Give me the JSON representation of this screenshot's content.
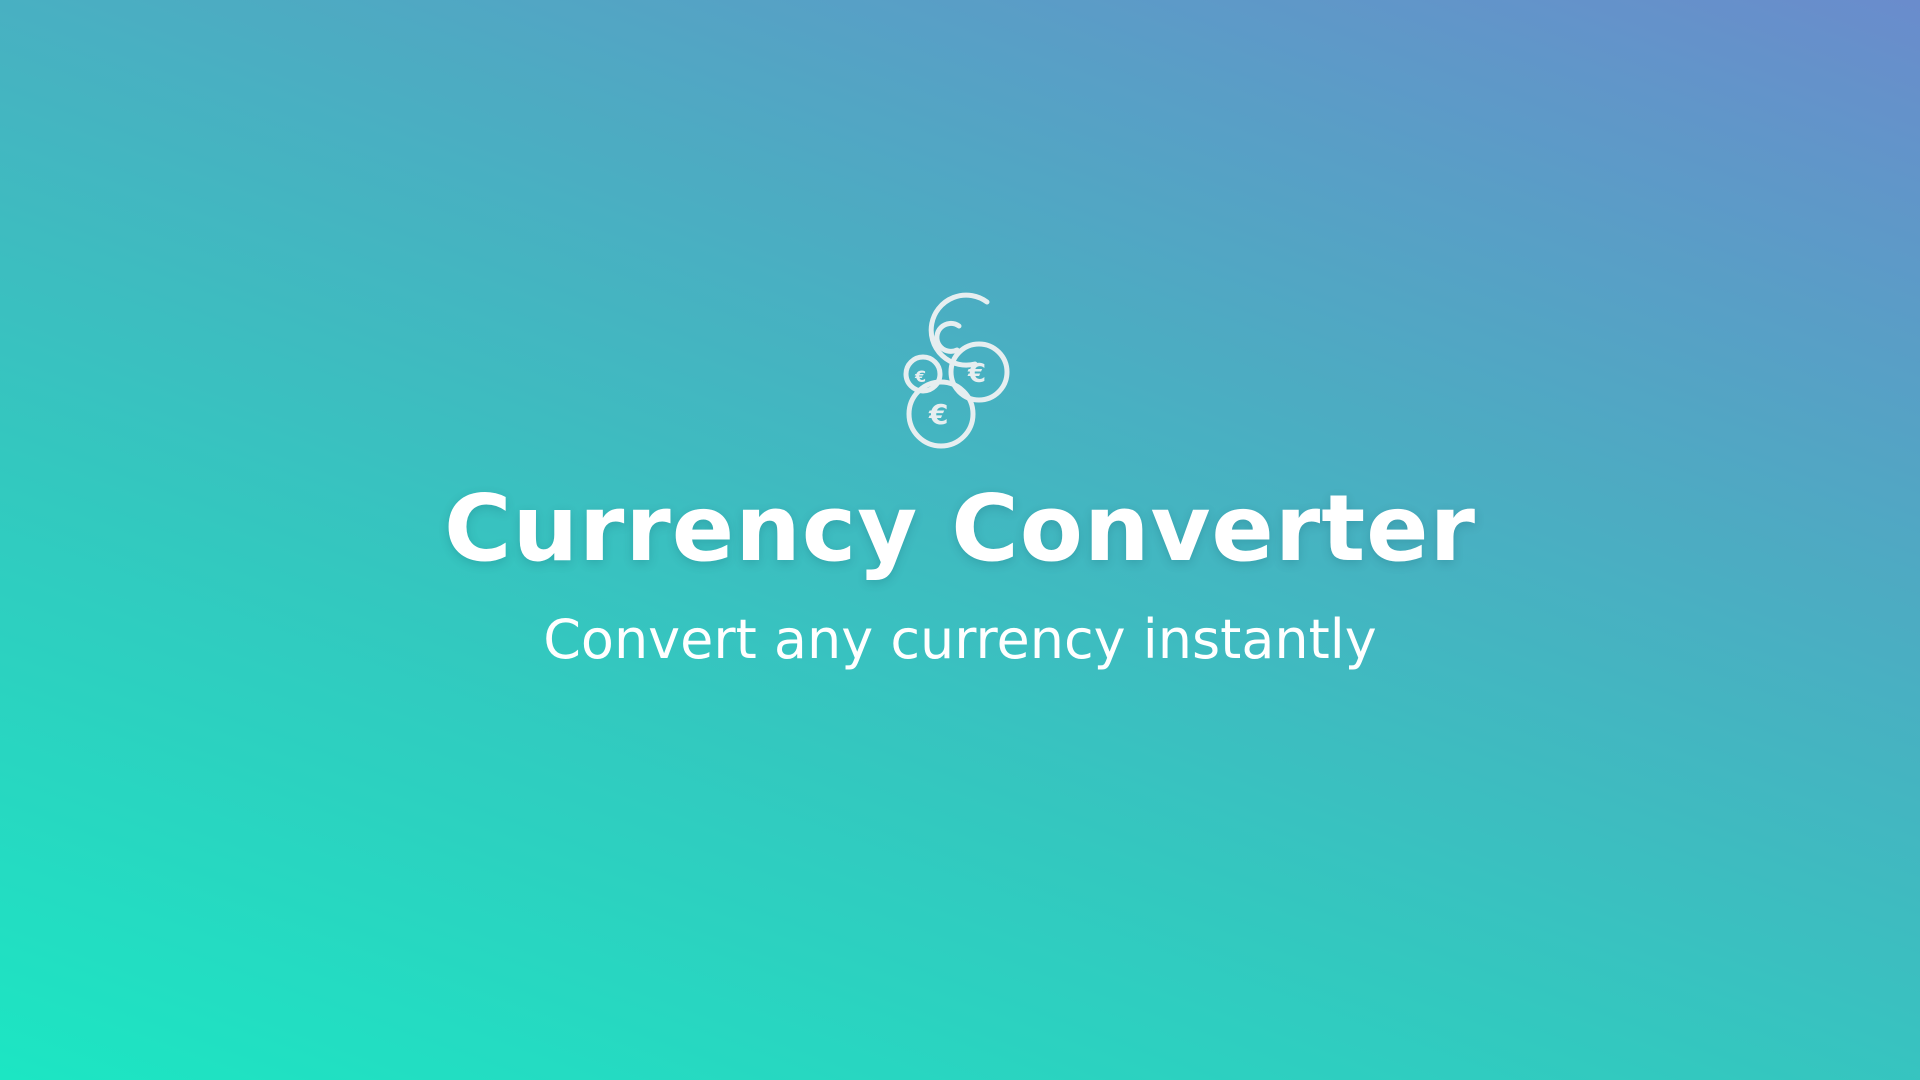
{
  "splash": {
    "logo_icon": "coins-currency-icon",
    "coin_symbol": "€",
    "title": "Currency Converter",
    "subtitle": "Convert any currency instantly"
  },
  "colors": {
    "gradient_top_right": "#6a8ccc",
    "gradient_bottom_left": "#1ce6c3",
    "text": "#ffffff",
    "icon_stroke": "#e6eef0"
  }
}
